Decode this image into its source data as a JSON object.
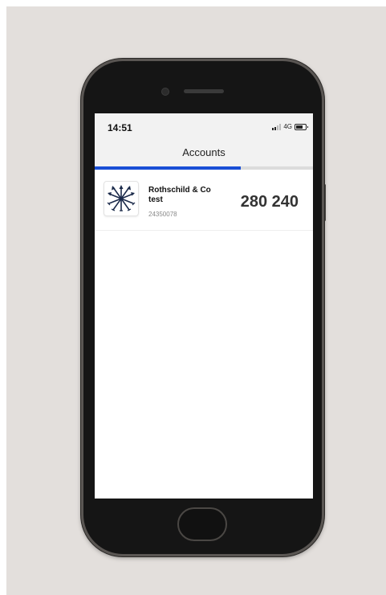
{
  "status_bar": {
    "time": "14:51",
    "network": "4G"
  },
  "nav": {
    "title": "Accounts"
  },
  "progress": {
    "percent": 67,
    "color": "#1a4fd6"
  },
  "accounts": [
    {
      "name": "Rothschild & Co test",
      "number": "24350078",
      "balance": "280 240",
      "logo": "arrows-bundle-icon"
    }
  ]
}
